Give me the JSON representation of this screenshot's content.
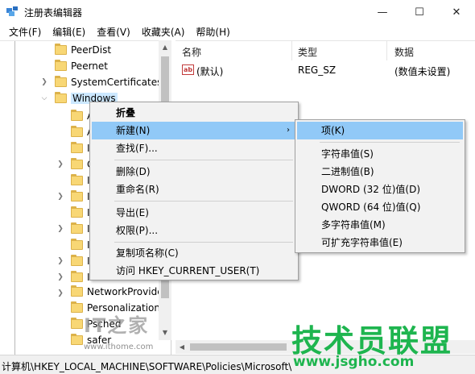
{
  "window": {
    "title": "注册表编辑器",
    "minimize": "—",
    "maximize": "☐",
    "close": "✕"
  },
  "menu": [
    "文件(F)",
    "编辑(E)",
    "查看(V)",
    "收藏夹(A)",
    "帮助(H)"
  ],
  "tree": {
    "items_above": [
      "PeerDist",
      "Peernet",
      "SystemCertificates"
    ],
    "selected": "Windows",
    "child_letters": [
      "A",
      "A",
      "I",
      "C",
      "I",
      "I",
      "I",
      "I",
      "I",
      "I",
      "I"
    ],
    "items_below": [
      "NetworkProvide",
      "Personalization",
      "Psched",
      "safer"
    ]
  },
  "list": {
    "columns": [
      "名称",
      "类型",
      "数据"
    ],
    "rows": [
      {
        "icon": "ab",
        "name": "(默认)",
        "type": "REG_SZ",
        "data": "(数值未设置)"
      }
    ]
  },
  "context_menu": [
    {
      "label": "折叠",
      "bold": true
    },
    {
      "label": "新建(N)",
      "highlight": true,
      "submenu": "›"
    },
    {
      "label": "查找(F)..."
    },
    {
      "label": "删除(D)"
    },
    {
      "label": "重命名(R)"
    },
    {
      "label": "导出(E)"
    },
    {
      "label": "权限(P)..."
    },
    {
      "label": "复制项名称(C)"
    },
    {
      "label": "访问 HKEY_CURRENT_USER(T)"
    }
  ],
  "submenu": [
    {
      "label": "项(K)",
      "highlight": true
    },
    {
      "label": "字符串值(S)"
    },
    {
      "label": "二进制值(B)"
    },
    {
      "label": "DWORD (32 位)值(D)"
    },
    {
      "label": "QWORD (64 位)值(Q)"
    },
    {
      "label": "多字符串值(M)"
    },
    {
      "label": "可扩充字符串值(E)"
    }
  ],
  "status": "计算机\\HKEY_LOCAL_MACHINE\\SOFTWARE\\Policies\\Microsoft\\",
  "watermark": {
    "logo_text": "IT之家",
    "url": "www.ithome.com",
    "brand": "技术员联盟",
    "brand_url": "www.jsgho.com"
  }
}
